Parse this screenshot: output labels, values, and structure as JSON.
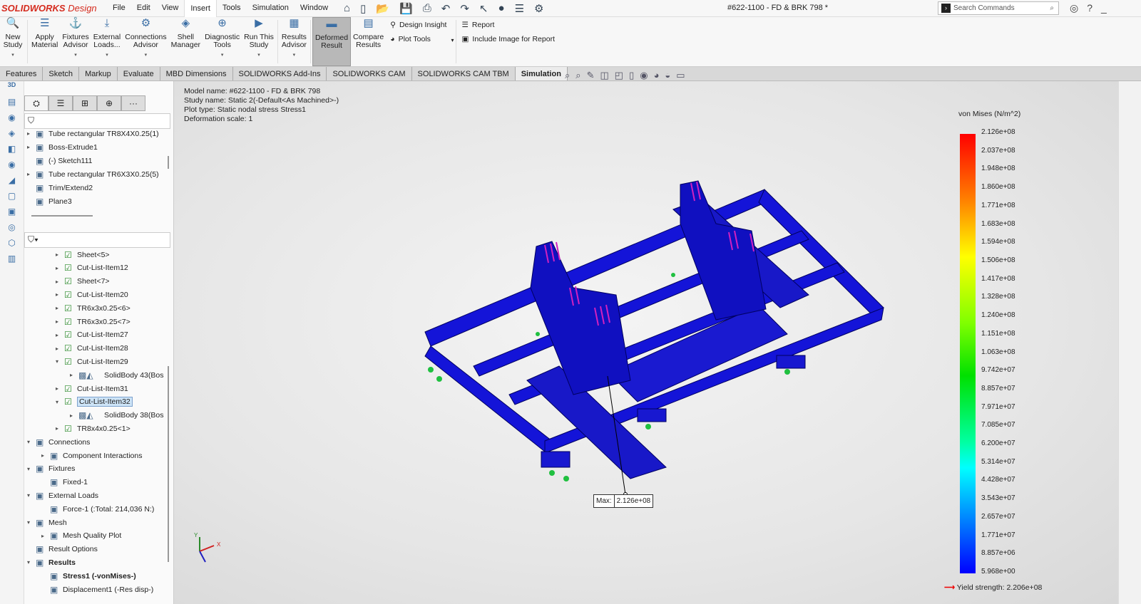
{
  "app": {
    "brand": "SOLIDWORKS",
    "brand_suffix": "Design",
    "doc_title": "#622-1100 - FD & BRK 798 *",
    "search_placeholder": "Search Commands"
  },
  "menu": [
    "File",
    "Edit",
    "View",
    "Insert",
    "Tools",
    "Simulation",
    "Window"
  ],
  "ribbon": {
    "buttons": [
      {
        "l1": "New",
        "l2": "Study",
        "icon": "new-study-icon",
        "dd": true
      },
      {
        "l1": "Apply",
        "l2": "Material",
        "icon": "material-icon",
        "dd": false
      },
      {
        "l1": "Fixtures",
        "l2": "Advisor",
        "icon": "fixtures-icon",
        "dd": true
      },
      {
        "l1": "External",
        "l2": "Loads...",
        "icon": "loads-icon",
        "dd": true
      },
      {
        "l1": "Connections",
        "l2": "Advisor",
        "icon": "connections-icon",
        "dd": true
      },
      {
        "l1": "Shell",
        "l2": "Manager",
        "icon": "shell-icon",
        "dd": false
      },
      {
        "l1": "Diagnostic",
        "l2": "Tools",
        "icon": "diagnostic-icon",
        "dd": true
      },
      {
        "l1": "Run This",
        "l2": "Study",
        "icon": "run-icon",
        "dd": true
      },
      {
        "l1": "Results",
        "l2": "Advisor",
        "icon": "results-icon",
        "dd": true
      },
      {
        "l1": "Deformed",
        "l2": "Result",
        "icon": "deformed-icon",
        "dd": false,
        "selected": true
      },
      {
        "l1": "Compare",
        "l2": "Results",
        "icon": "compare-icon",
        "dd": false
      }
    ],
    "small": [
      "Design Insight",
      "Plot Tools"
    ],
    "report": [
      "Report",
      "Include Image for Report"
    ]
  },
  "tabs": [
    "Features",
    "Sketch",
    "Markup",
    "Evaluate",
    "MBD Dimensions",
    "SOLIDWORKS Add-Ins",
    "SOLIDWORKS CAM",
    "SOLIDWORKS CAM TBM",
    "Simulation"
  ],
  "active_tab": "Simulation",
  "tree_top": [
    {
      "label": "Tube rectangular TR8X4X0.25(1)",
      "arrow": true
    },
    {
      "label": "Boss-Extrude1",
      "arrow": true
    },
    {
      "label": "(-) Sketch111",
      "arrow": false
    },
    {
      "label": "Tube rectangular TR6X3X0.25(5)",
      "arrow": true
    },
    {
      "label": "Trim/Extend2",
      "arrow": false
    },
    {
      "label": "Plane3",
      "arrow": false
    }
  ],
  "tree_bottom": [
    {
      "label": "Sheet<5>",
      "lvl": 2,
      "arrow": "▸"
    },
    {
      "label": "Cut-List-Item12",
      "lvl": 2,
      "arrow": "▸"
    },
    {
      "label": "Sheet<7>",
      "lvl": 2,
      "arrow": "▸"
    },
    {
      "label": "Cut-List-Item20",
      "lvl": 2,
      "arrow": "▸"
    },
    {
      "label": "TR6x3x0.25<6>",
      "lvl": 2,
      "arrow": "▸"
    },
    {
      "label": "TR6x3x0.25<7>",
      "lvl": 2,
      "arrow": "▸"
    },
    {
      "label": "Cut-List-Item27",
      "lvl": 2,
      "arrow": "▸"
    },
    {
      "label": "Cut-List-Item28",
      "lvl": 2,
      "arrow": "▸"
    },
    {
      "label": "Cut-List-Item29",
      "lvl": 2,
      "arrow": "▾"
    },
    {
      "label": "SolidBody 43(Bos",
      "lvl": 3,
      "arrow": "▸"
    },
    {
      "label": "Cut-List-Item31",
      "lvl": 2,
      "arrow": "▸"
    },
    {
      "label": "Cut-List-Item32",
      "lvl": 2,
      "arrow": "▾",
      "selected": true
    },
    {
      "label": "SolidBody 38(Bos",
      "lvl": 3,
      "arrow": "▸"
    },
    {
      "label": "TR8x4x0.25<1>",
      "lvl": 2,
      "arrow": "▸"
    },
    {
      "label": "Connections",
      "lvl": 0,
      "arrow": "▾"
    },
    {
      "label": "Component Interactions",
      "lvl": 1,
      "arrow": "▸"
    },
    {
      "label": "Fixtures",
      "lvl": 0,
      "arrow": "▾"
    },
    {
      "label": "Fixed-1",
      "lvl": 1,
      "arrow": ""
    },
    {
      "label": "External Loads",
      "lvl": 0,
      "arrow": "▾"
    },
    {
      "label": "Force-1 (:Total: 214,036 N:)",
      "lvl": 1,
      "arrow": ""
    },
    {
      "label": "Mesh",
      "lvl": 0,
      "arrow": "▾"
    },
    {
      "label": "Mesh Quality Plot",
      "lvl": 1,
      "arrow": "▸"
    },
    {
      "label": "Result Options",
      "lvl": 0,
      "arrow": ""
    },
    {
      "label": "Results",
      "lvl": 0,
      "arrow": "▾",
      "bold": true
    },
    {
      "label": "Stress1 (-vonMises-)",
      "lvl": 1,
      "arrow": "",
      "bold": true
    },
    {
      "label": "Displacement1 (-Res disp-)",
      "lvl": 1,
      "arrow": ""
    }
  ],
  "info": [
    "Model name: #622-1100 - FD & BRK 798",
    "Study name: Static 2(-Default<As Machined>-)",
    "Plot type: Static nodal stress Stress1",
    "Deformation scale: 1"
  ],
  "legend": {
    "title": "von Mises (N/m^2)",
    "labels": [
      "2.126e+08",
      "2.037e+08",
      "1.948e+08",
      "1.860e+08",
      "1.771e+08",
      "1.683e+08",
      "1.594e+08",
      "1.506e+08",
      "1.417e+08",
      "1.328e+08",
      "1.240e+08",
      "1.151e+08",
      "1.063e+08",
      "9.742e+07",
      "8.857e+07",
      "7.971e+07",
      "7.085e+07",
      "6.200e+07",
      "5.314e+07",
      "4.428e+07",
      "3.543e+07",
      "2.657e+07",
      "1.771e+07",
      "8.857e+06",
      "5.968e+00"
    ],
    "yield": "Yield strength: 2.206e+08"
  },
  "max": {
    "label": "Max:",
    "value": "2.126e+08"
  },
  "colors": {
    "model": "#1010d8",
    "load": "#d020c0",
    "fixture": "#20a020"
  }
}
